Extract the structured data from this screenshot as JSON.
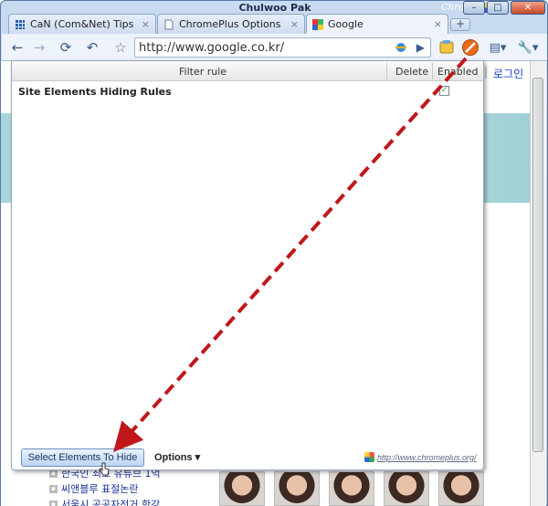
{
  "window": {
    "title": "Chulwoo Pak",
    "brand": "ChromePlus",
    "controls": {
      "minimize": "–",
      "maximize": "□",
      "close": "✕"
    }
  },
  "tabs": [
    {
      "label": "CaN (Com&Net) Tips",
      "icon": "grid-icon",
      "close": "×"
    },
    {
      "label": "ChromePlus Options P...",
      "icon": "page-icon",
      "close": "×"
    },
    {
      "label": "Google",
      "icon": "google-icon",
      "close": "×",
      "active": true
    }
  ],
  "newtab_label": "+",
  "toolbar": {
    "back": "←",
    "forward": "→",
    "reload": "⟳",
    "undo": "↶",
    "star": "☆",
    "url": "http://www.google.co.kr/",
    "go": "▶",
    "page_menu": "▤▾",
    "tools_menu": "🔧▾"
  },
  "page": {
    "login_link": "로그인",
    "news": [
      "한국인 최초 유튜브 1억",
      "씨앤블루 표절논란",
      "서울시 공공자전거 한강"
    ],
    "photos": 5
  },
  "popup": {
    "columns": {
      "filter_rule": "Filter rule",
      "delete": "Delete",
      "enabled": "Enabled"
    },
    "section_title": "Site Elements Hiding Rules",
    "enabled_mark": "✓",
    "select_button": "Select Elements To Hide",
    "options_button": "Options ▾",
    "credit": "http://www.chromeplus.org/"
  },
  "colors": {
    "arrow": "#c0171b",
    "accent": "#3a5a8a",
    "block_icon": "#e86a1a"
  }
}
